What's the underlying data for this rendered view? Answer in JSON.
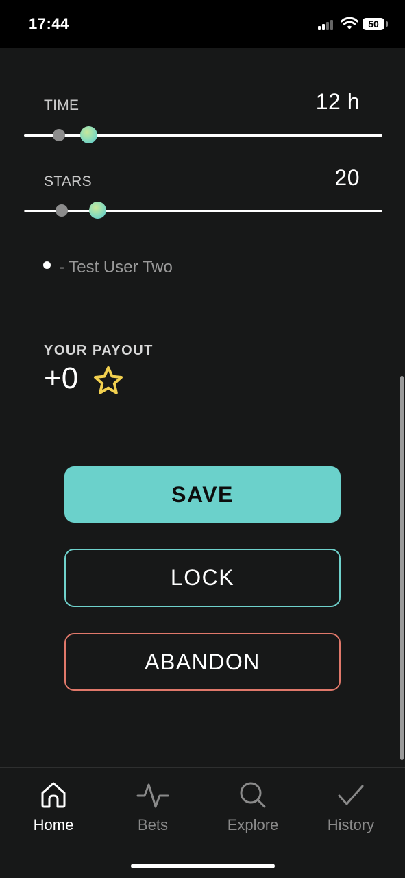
{
  "status_bar": {
    "time": "17:44",
    "battery": "50"
  },
  "time_field": {
    "label": "TIME",
    "value": "12 h"
  },
  "stars_field": {
    "label": "STARS",
    "value": "20"
  },
  "participant": {
    "name": "- Test User Two"
  },
  "payout": {
    "label": "YOUR PAYOUT",
    "value": "+0"
  },
  "buttons": {
    "save": "SAVE",
    "lock": "LOCK",
    "abandon": "ABANDON"
  },
  "nav": {
    "items": [
      {
        "label": "Home",
        "icon": "home-icon",
        "active": true
      },
      {
        "label": "Bets",
        "icon": "activity-icon",
        "active": false
      },
      {
        "label": "Explore",
        "icon": "search-icon",
        "active": false
      },
      {
        "label": "History",
        "icon": "check-icon",
        "active": false
      }
    ]
  },
  "colors": {
    "background": "#171818",
    "accent_teal": "#6bd1cb",
    "danger": "#e0786a",
    "star": "#f2d04f",
    "nav_active": "#ffffff",
    "nav_inactive": "#8a8a8a"
  }
}
